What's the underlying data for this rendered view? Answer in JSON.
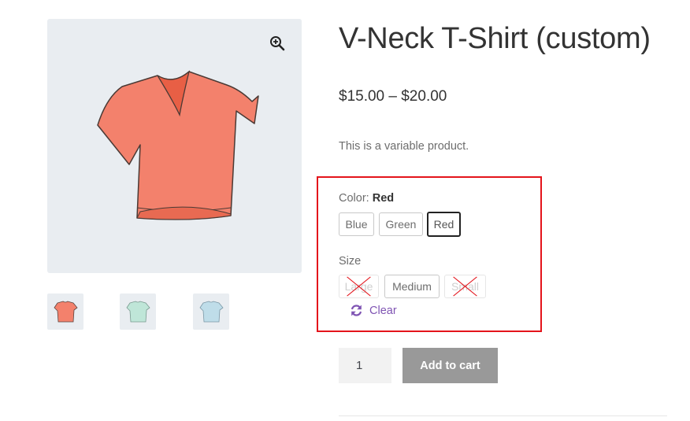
{
  "product": {
    "title": "V-Neck T-Shirt (custom)",
    "price": "$15.00 – $20.00",
    "description": "This is a variable product."
  },
  "gallery": {
    "zoom_icon": "zoom-in-icon",
    "thumbnails": [
      {
        "name": "red-shirt-thumbnail",
        "color": "#f3816c"
      },
      {
        "name": "green-shirt-thumbnail",
        "color": "#bfe6d8"
      },
      {
        "name": "blue-shirt-thumbnail",
        "color": "#bfdde9"
      }
    ]
  },
  "variations": {
    "color": {
      "label": "Color:",
      "selected": "Red",
      "options": [
        {
          "label": "Blue",
          "state": "available"
        },
        {
          "label": "Green",
          "state": "available"
        },
        {
          "label": "Red",
          "state": "selected"
        }
      ]
    },
    "size": {
      "label": "Size",
      "options": [
        {
          "label": "Large",
          "state": "unavailable"
        },
        {
          "label": "Medium",
          "state": "available"
        },
        {
          "label": "Small",
          "state": "unavailable"
        }
      ]
    },
    "clear_label": "Clear",
    "clear_icon": "refresh-icon"
  },
  "cart": {
    "quantity": "1",
    "add_to_cart_label": "Add to cart"
  },
  "colors": {
    "accent": "#7f54b3",
    "highlight_border": "#e4141b",
    "button_bg": "#999999",
    "shirt_red": "#f3816c"
  }
}
